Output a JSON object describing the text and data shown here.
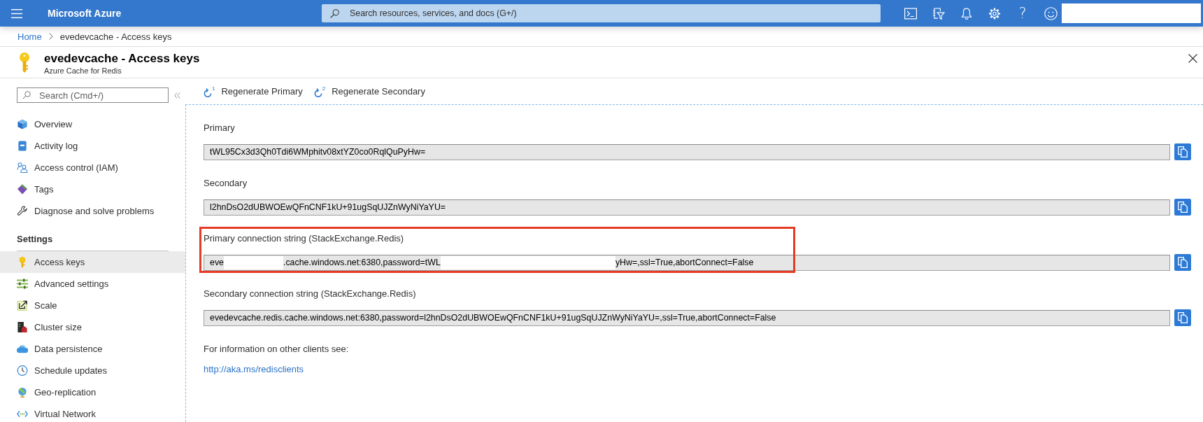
{
  "top_bar": {
    "brand": "Microsoft Azure",
    "search": {
      "placeholder": "Search resources, services, and docs (G+/)"
    },
    "help_glyph": "?"
  },
  "breadcrumb": [
    {
      "kind": "link",
      "label": "Home"
    },
    {
      "kind": "current",
      "label": "evedevcache - Access keys"
    }
  ],
  "header": {
    "title": "evedevcache - Access keys",
    "subtitle": "Azure Cache for Redis"
  },
  "sidebar": {
    "search": {
      "placeholder": "Search (Cmd+/)"
    },
    "groups": [
      {
        "items": [
          {
            "label": "Overview",
            "selected": false
          },
          {
            "label": "Activity log",
            "selected": false
          },
          {
            "label": "Access control (IAM)",
            "selected": false
          },
          {
            "label": "Tags",
            "selected": false
          },
          {
            "label": "Diagnose and solve problems",
            "selected": false
          }
        ]
      },
      {
        "heading": "Settings",
        "items": [
          {
            "label": "Access keys",
            "selected": true
          },
          {
            "label": "Advanced settings",
            "selected": false
          },
          {
            "label": "Scale",
            "selected": false
          },
          {
            "label": "Cluster size",
            "selected": false
          },
          {
            "label": "Data persistence",
            "selected": false
          },
          {
            "label": "Schedule updates",
            "selected": false
          },
          {
            "label": "Geo-replication",
            "selected": false
          },
          {
            "label": "Virtual Network",
            "selected": false
          }
        ]
      }
    ]
  },
  "toolbar": [
    {
      "label": "Regenerate Primary",
      "icon_number": "1"
    },
    {
      "label": "Regenerate Secondary",
      "icon_number": "2"
    }
  ],
  "fields": [
    {
      "label": "Primary",
      "highlighted": false,
      "value": [
        {
          "kind": "text",
          "text": "tWL95Cx3d3Qh0Tdi6WMphitv08xtYZ0co0RqlQuPyHw="
        }
      ]
    },
    {
      "label": "Secondary",
      "highlighted": false,
      "value": [
        {
          "kind": "text",
          "text": "l2hnDsO2dUBWOEwQFnCNF1kU+91ugSqUJZnWyNiYaYU="
        }
      ]
    },
    {
      "label": "Primary connection string (StackExchange.Redis)",
      "highlighted": true,
      "value": [
        {
          "kind": "text",
          "text": "eve"
        },
        {
          "kind": "redacted"
        },
        {
          "kind": "text",
          "text": ".cache.windows.net:6380,password=tWL"
        },
        {
          "kind": "redacted"
        },
        {
          "kind": "text",
          "text": "yHw=,ssl=True,abortConnect=False"
        }
      ]
    },
    {
      "label": "Secondary connection string (StackExchange.Redis)",
      "highlighted": false,
      "value": [
        {
          "kind": "text",
          "text": "evedevcache.redis.cache.windows.net:6380,password=l2hnDsO2dUBWOEwQFnCNF1kU+91ugSqUJZnWyNiYaYU=,ssl=True,abortConnect=False"
        }
      ]
    }
  ],
  "footer": {
    "text": "For information on other clients see:",
    "link": "http://aka.ms/redisclients"
  }
}
